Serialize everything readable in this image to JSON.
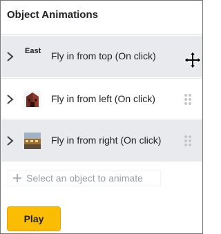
{
  "panel": {
    "title": "Object Animations"
  },
  "animations": [
    {
      "thumb_text": "East",
      "label": "Fly in from top  (On click)"
    },
    {
      "label": "Fly in from left  (On click)"
    },
    {
      "label": "Fly in from right  (On click)"
    }
  ],
  "add_object": {
    "label": "Select an object to animate"
  },
  "play_button": {
    "label": "Play"
  },
  "colors": {
    "row_selected_bg": "#e8eaed",
    "play_bg": "#fbbc04",
    "border": "#747775"
  }
}
